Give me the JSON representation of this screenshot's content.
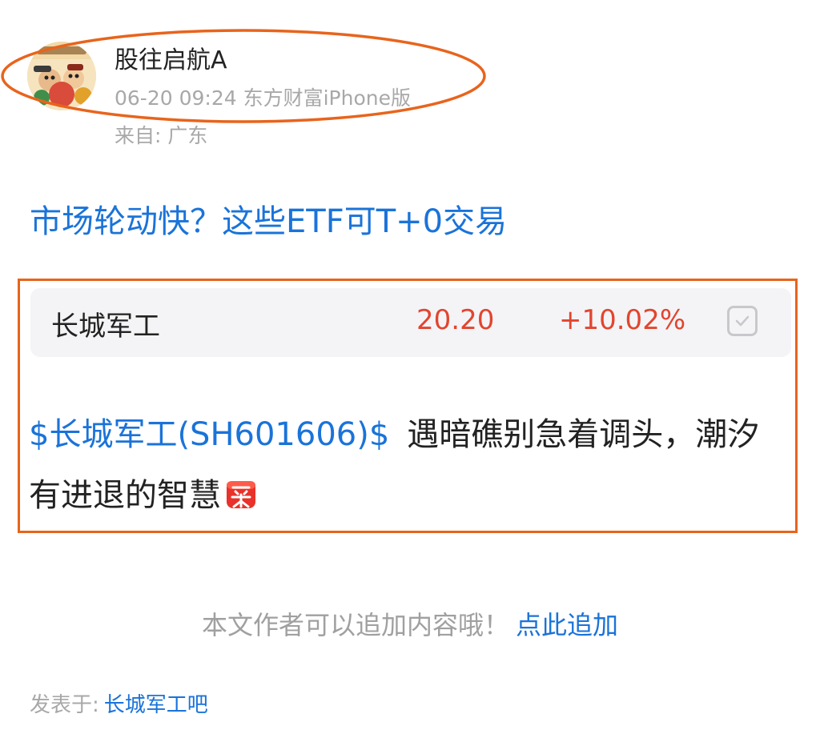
{
  "author": {
    "name": "股往启航A",
    "meta": "06-20 09:24 东方财富iPhone版",
    "location": "来自: 广东"
  },
  "post": {
    "title": "市场轮动快？这些ETF可T+0交易",
    "content_tag": "$长城军工(SH601606)$",
    "content_text": "遇暗礁别急着调头，潮汐有进退的智慧",
    "emoji": "buy-emoji"
  },
  "stock": {
    "name": "长城军工",
    "price": "20.20",
    "change": "+10.02%",
    "up_color": "#e2452f"
  },
  "footer": {
    "add_prompt": "本文作者可以追加内容哦！",
    "add_link": "点此追加",
    "posted_label": "发表于:",
    "bar_name": "长城军工吧"
  },
  "colors": {
    "accent": "#1a73d9",
    "highlight": "#e8641c"
  }
}
